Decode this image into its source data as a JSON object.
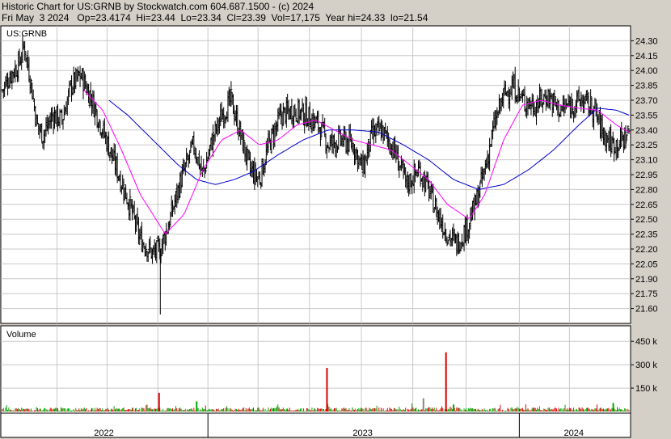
{
  "header": {
    "line1": "Historic Chart for US:GRNB by Stockwatch.com 604.687.1500 - (c) 2024",
    "line2": "Fri May  3 2024   Op=23.4174  Hi=23.44  Lo=23.34  Cl=23.39  Vol=17,175  Year hi=24.33  lo=21.54"
  },
  "colors": {
    "background": "#d4d0c8",
    "panel": "#ffffff",
    "grid": "#c8c8c8",
    "bar": "#000000",
    "ma_fast": "#ff00ff",
    "ma_slow": "#0000cc",
    "vol_up": "#00aa00",
    "vol_down": "#dd0000",
    "vol_flat": "#888888"
  },
  "chart_data": {
    "type": "line",
    "symbol": "US:GRNB",
    "price_axis": {
      "ticks": [
        "24.30",
        "24.15",
        "24.00",
        "23.85",
        "23.70",
        "23.55",
        "23.40",
        "23.25",
        "23.10",
        "22.95",
        "22.80",
        "22.65",
        "22.50",
        "22.35",
        "22.20",
        "22.05",
        "21.90",
        "21.75",
        "21.60"
      ],
      "ylim": [
        21.45,
        24.45
      ]
    },
    "volume_axis": {
      "label": "Volume",
      "ticks": [
        "450 k",
        "300 k",
        "150 k"
      ],
      "ylim": [
        0,
        560
      ]
    },
    "x_axis": {
      "labels": [
        "2022",
        "2023",
        "2024"
      ]
    },
    "price_anchors": [
      {
        "t": 0.0,
        "v": 23.8
      },
      {
        "t": 0.012,
        "v": 23.95
      },
      {
        "t": 0.025,
        "v": 24.05
      },
      {
        "t": 0.035,
        "v": 24.25
      },
      {
        "t": 0.045,
        "v": 23.9
      },
      {
        "t": 0.055,
        "v": 23.45
      },
      {
        "t": 0.065,
        "v": 23.35
      },
      {
        "t": 0.08,
        "v": 23.55
      },
      {
        "t": 0.095,
        "v": 23.5
      },
      {
        "t": 0.11,
        "v": 23.85
      },
      {
        "t": 0.125,
        "v": 23.95
      },
      {
        "t": 0.14,
        "v": 23.75
      },
      {
        "t": 0.16,
        "v": 23.4
      },
      {
        "t": 0.18,
        "v": 23.05
      },
      {
        "t": 0.2,
        "v": 22.7
      },
      {
        "t": 0.22,
        "v": 22.3
      },
      {
        "t": 0.24,
        "v": 22.15
      },
      {
        "t": 0.252,
        "v": 22.2
      },
      {
        "t": 0.265,
        "v": 22.45
      },
      {
        "t": 0.285,
        "v": 22.9
      },
      {
        "t": 0.305,
        "v": 23.25
      },
      {
        "t": 0.32,
        "v": 22.95
      },
      {
        "t": 0.335,
        "v": 23.3
      },
      {
        "t": 0.35,
        "v": 23.55
      },
      {
        "t": 0.365,
        "v": 23.7
      },
      {
        "t": 0.38,
        "v": 23.35
      },
      {
        "t": 0.395,
        "v": 23.0
      },
      {
        "t": 0.41,
        "v": 22.9
      },
      {
        "t": 0.425,
        "v": 23.25
      },
      {
        "t": 0.445,
        "v": 23.55
      },
      {
        "t": 0.465,
        "v": 23.6
      },
      {
        "t": 0.485,
        "v": 23.55
      },
      {
        "t": 0.505,
        "v": 23.45
      },
      {
        "t": 0.52,
        "v": 23.25
      },
      {
        "t": 0.54,
        "v": 23.3
      },
      {
        "t": 0.56,
        "v": 23.25
      },
      {
        "t": 0.575,
        "v": 23.0
      },
      {
        "t": 0.59,
        "v": 23.35
      },
      {
        "t": 0.605,
        "v": 23.4
      },
      {
        "t": 0.625,
        "v": 23.2
      },
      {
        "t": 0.645,
        "v": 22.85
      },
      {
        "t": 0.665,
        "v": 23.0
      },
      {
        "t": 0.68,
        "v": 22.8
      },
      {
        "t": 0.695,
        "v": 22.55
      },
      {
        "t": 0.71,
        "v": 22.35
      },
      {
        "t": 0.725,
        "v": 22.25
      },
      {
        "t": 0.74,
        "v": 22.4
      },
      {
        "t": 0.755,
        "v": 22.65
      },
      {
        "t": 0.77,
        "v": 23.0
      },
      {
        "t": 0.785,
        "v": 23.45
      },
      {
        "t": 0.8,
        "v": 23.75
      },
      {
        "t": 0.815,
        "v": 23.85
      },
      {
        "t": 0.83,
        "v": 23.7
      },
      {
        "t": 0.85,
        "v": 23.65
      },
      {
        "t": 0.87,
        "v": 23.75
      },
      {
        "t": 0.89,
        "v": 23.6
      },
      {
        "t": 0.905,
        "v": 23.65
      },
      {
        "t": 0.925,
        "v": 23.7
      },
      {
        "t": 0.945,
        "v": 23.6
      },
      {
        "t": 0.96,
        "v": 23.35
      },
      {
        "t": 0.975,
        "v": 23.25
      },
      {
        "t": 0.99,
        "v": 23.3
      },
      {
        "t": 1.0,
        "v": 23.39
      }
    ],
    "ma_fast": [
      {
        "t": 0.13,
        "v": 23.8
      },
      {
        "t": 0.16,
        "v": 23.6
      },
      {
        "t": 0.19,
        "v": 23.2
      },
      {
        "t": 0.22,
        "v": 22.75
      },
      {
        "t": 0.26,
        "v": 22.35
      },
      {
        "t": 0.29,
        "v": 22.55
      },
      {
        "t": 0.32,
        "v": 23.0
      },
      {
        "t": 0.35,
        "v": 23.3
      },
      {
        "t": 0.38,
        "v": 23.4
      },
      {
        "t": 0.41,
        "v": 23.25
      },
      {
        "t": 0.44,
        "v": 23.3
      },
      {
        "t": 0.47,
        "v": 23.45
      },
      {
        "t": 0.5,
        "v": 23.5
      },
      {
        "t": 0.53,
        "v": 23.4
      },
      {
        "t": 0.56,
        "v": 23.3
      },
      {
        "t": 0.59,
        "v": 23.25
      },
      {
        "t": 0.62,
        "v": 23.2
      },
      {
        "t": 0.65,
        "v": 23.05
      },
      {
        "t": 0.68,
        "v": 22.9
      },
      {
        "t": 0.71,
        "v": 22.65
      },
      {
        "t": 0.745,
        "v": 22.5
      },
      {
        "t": 0.77,
        "v": 22.75
      },
      {
        "t": 0.8,
        "v": 23.3
      },
      {
        "t": 0.83,
        "v": 23.65
      },
      {
        "t": 0.86,
        "v": 23.7
      },
      {
        "t": 0.89,
        "v": 23.65
      },
      {
        "t": 0.92,
        "v": 23.62
      },
      {
        "t": 0.95,
        "v": 23.6
      },
      {
        "t": 0.98,
        "v": 23.45
      },
      {
        "t": 1.0,
        "v": 23.38
      }
    ],
    "ma_slow": [
      {
        "t": 0.17,
        "v": 23.7
      },
      {
        "t": 0.2,
        "v": 23.55
      },
      {
        "t": 0.24,
        "v": 23.3
      },
      {
        "t": 0.28,
        "v": 23.05
      },
      {
        "t": 0.31,
        "v": 22.9
      },
      {
        "t": 0.34,
        "v": 22.85
      },
      {
        "t": 0.37,
        "v": 22.9
      },
      {
        "t": 0.4,
        "v": 22.98
      },
      {
        "t": 0.44,
        "v": 23.15
      },
      {
        "t": 0.48,
        "v": 23.3
      },
      {
        "t": 0.52,
        "v": 23.4
      },
      {
        "t": 0.56,
        "v": 23.4
      },
      {
        "t": 0.6,
        "v": 23.38
      },
      {
        "t": 0.64,
        "v": 23.25
      },
      {
        "t": 0.68,
        "v": 23.1
      },
      {
        "t": 0.72,
        "v": 22.9
      },
      {
        "t": 0.76,
        "v": 22.8
      },
      {
        "t": 0.8,
        "v": 22.85
      },
      {
        "t": 0.84,
        "v": 23.0
      },
      {
        "t": 0.88,
        "v": 23.2
      },
      {
        "t": 0.92,
        "v": 23.45
      },
      {
        "t": 0.95,
        "v": 23.62
      },
      {
        "t": 0.98,
        "v": 23.6
      },
      {
        "t": 1.0,
        "v": 23.55
      }
    ],
    "volume_spikes": [
      {
        "t": 0.25,
        "v": 120,
        "dir": "down"
      },
      {
        "t": 0.31,
        "v": 65,
        "dir": "up"
      },
      {
        "t": 0.518,
        "v": 280,
        "dir": "down"
      },
      {
        "t": 0.672,
        "v": 85,
        "dir": "flat"
      },
      {
        "t": 0.708,
        "v": 380,
        "dir": "down"
      },
      {
        "t": 0.72,
        "v": 45,
        "dir": "up"
      },
      {
        "t": 0.975,
        "v": 55,
        "dir": "up"
      }
    ],
    "spike_low": {
      "t": 0.252,
      "v": 21.54
    }
  }
}
